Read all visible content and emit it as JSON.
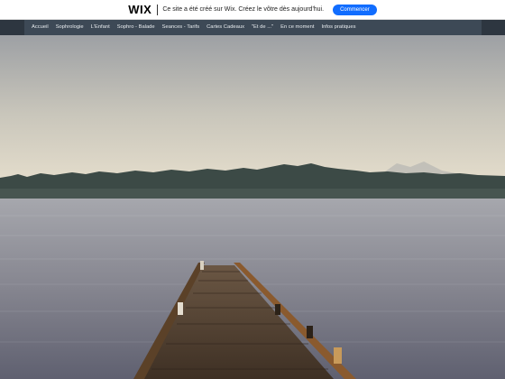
{
  "banner": {
    "logo": "WIX",
    "message": "Ce site a été créé sur Wix. Créez le vôtre dès aujourd'hui.",
    "cta": "Commencer"
  },
  "nav": {
    "items": [
      {
        "label": "Accueil"
      },
      {
        "label": "Sophrologie"
      },
      {
        "label": "L'Enfant"
      },
      {
        "label": "Sophro - Balade"
      },
      {
        "label": "Seances - Tarifs"
      },
      {
        "label": "Cartes Cadeaux"
      },
      {
        "label": "\"Et de ...\""
      },
      {
        "label": "En ce moment"
      },
      {
        "label": "Infos pratiques"
      }
    ]
  },
  "hero": {
    "image": "wooden pier over calm lake at dusk",
    "colors": {
      "sky_top": "#9da0a4",
      "sky_bottom": "#e3dccb",
      "water_top": "#a6a7ad",
      "water_bottom": "#5f6070",
      "treeline": "#3c4a46",
      "dock": "#5a4530"
    }
  }
}
